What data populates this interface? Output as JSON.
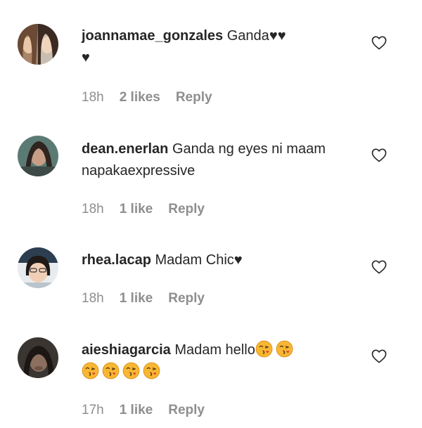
{
  "comments": [
    {
      "username": "joannamae_gonzales",
      "text": "Ganda",
      "trailing": "♥♥",
      "trailing2": "♥",
      "time": "18h",
      "likes": "2 likes",
      "reply": "Reply"
    },
    {
      "username": "dean.enerlan",
      "text": "Ganda ng eyes ni maam napakaexpressive",
      "time": "18h",
      "likes": "1 like",
      "reply": "Reply"
    },
    {
      "username": "rhea.lacap",
      "text": "Madam Chic",
      "trailing": "♥",
      "time": "18h",
      "likes": "1 like",
      "reply": "Reply"
    },
    {
      "username": "aieshiagarcia",
      "text": "Madam hello",
      "emoji_name": "face-blowing-kiss-emoji",
      "time": "17h",
      "likes": "1 like",
      "reply": "Reply"
    }
  ],
  "colors": {
    "text": "#262626",
    "meta": "#8e8e8e",
    "emoji": "#f7b733"
  },
  "icons": {
    "like": "heart-outline-icon"
  }
}
